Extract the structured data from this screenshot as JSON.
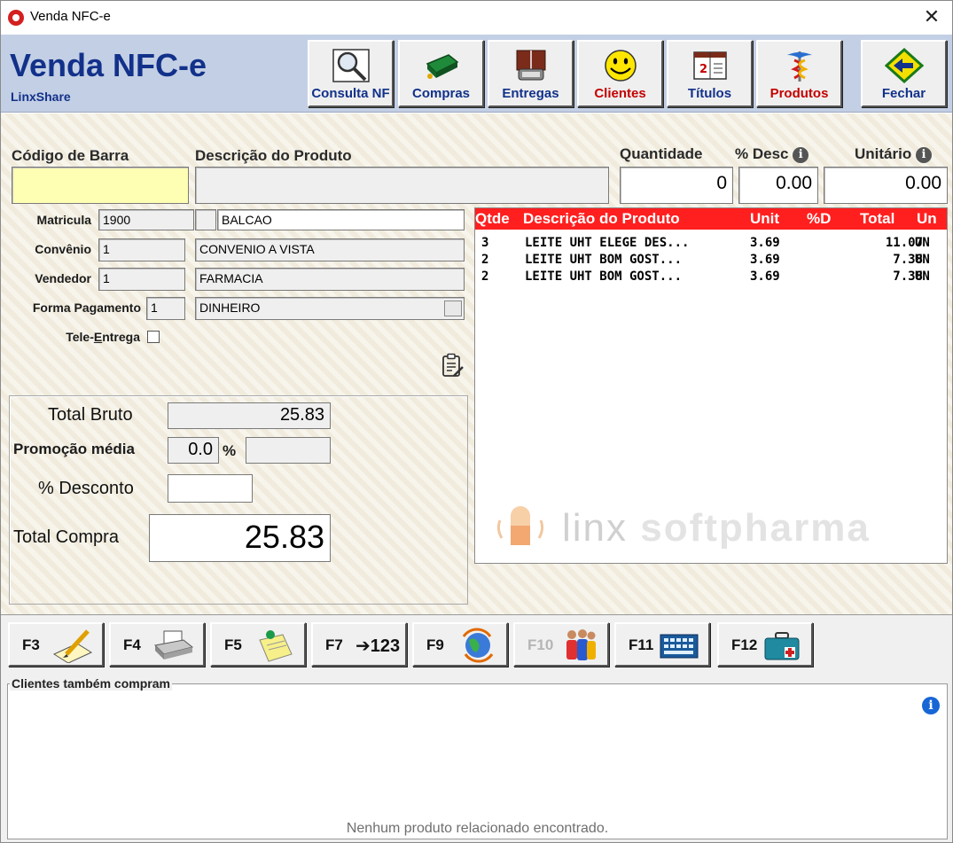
{
  "window": {
    "title": "Venda NFC-e",
    "close_glyph": "✕"
  },
  "header": {
    "title": "Venda NFC-e",
    "subtitle": "LinxShare",
    "buttons": [
      {
        "label": "Consulta NF",
        "icon": "magnifier-icon",
        "color": "#12318a"
      },
      {
        "label": "Compras",
        "icon": "cash-register-icon",
        "color": "#12318a"
      },
      {
        "label": "Entregas",
        "icon": "telephone-book-icon",
        "color": "#12318a"
      },
      {
        "label": "Clientes",
        "icon": "smiley-icon",
        "color": "#c40000"
      },
      {
        "label": "Títulos",
        "icon": "calendar-book-icon",
        "color": "#12318a"
      },
      {
        "label": "Produtos",
        "icon": "caduceus-icon",
        "color": "#c40000"
      },
      {
        "label": "Fechar",
        "icon": "back-arrow-icon",
        "color": "#12318a"
      }
    ]
  },
  "entry": {
    "barcode_label": "Código de Barra",
    "barcode_value": "",
    "description_label": "Descrição do Produto",
    "description_value": "",
    "quantity_label": "Quantidade",
    "quantity_value": "0",
    "discount_label": "% Desc",
    "discount_value": "0.00",
    "unit_label": "Unitário",
    "unit_value": "0.00",
    "info_glyph": "i"
  },
  "form": {
    "matricula_label": "Matricula",
    "matricula_code": "1900",
    "matricula_name": "BALCAO",
    "convenio_label": "Convênio",
    "convenio_code": "1",
    "convenio_name": "CONVENIO A VISTA",
    "vendedor_label": "Vendedor",
    "vendedor_code": "1",
    "vendedor_name": "FARMACIA",
    "pagamento_label": "Forma Pagamento",
    "pagamento_code": "1",
    "pagamento_name": "DINHEIRO",
    "tele_label_pre": "Tele-",
    "tele_label_underlined": "E",
    "tele_label_post": "ntrega",
    "tele_checked": false
  },
  "totals": {
    "bruto_label": "Total Bruto",
    "bruto_value": "25.83",
    "promo_label": "Promoção média",
    "promo_value": "0.0",
    "promo_unit": "%",
    "promo_extra": "",
    "desconto_label": "% Desconto",
    "desconto_value": "",
    "compra_label": "Total Compra",
    "compra_value": "25.83"
  },
  "items": {
    "header": {
      "qtde": "Qtde",
      "desc": "Descrição do Produto",
      "unit": "Unit",
      "pd": "%D",
      "total": "Total",
      "un": "Un"
    },
    "rows": [
      {
        "qtde": "3",
        "desc": "LEITE UHT ELEGE DES...",
        "unit": "3.69",
        "pd": "",
        "total": "11.07",
        "un": "UN"
      },
      {
        "qtde": "2",
        "desc": "LEITE UHT BOM GOST...",
        "unit": "3.69",
        "pd": "",
        "total": "7.38",
        "un": "UN"
      },
      {
        "qtde": "2",
        "desc": "LEITE UHT BOM GOST...",
        "unit": "3.69",
        "pd": "",
        "total": "7.38",
        "un": "UN"
      }
    ],
    "watermark_a": "linx",
    "watermark_b": "softpharma"
  },
  "fkeys": [
    {
      "key": "F3",
      "icon": "pencil-paper-icon",
      "enabled": true
    },
    {
      "key": "F4",
      "icon": "printer-icon",
      "enabled": true
    },
    {
      "key": "F5",
      "icon": "sticky-note-icon",
      "enabled": true
    },
    {
      "key": "F7",
      "icon": "arrow-123-icon",
      "enabled": true,
      "text": "➔123"
    },
    {
      "key": "F9",
      "icon": "globe-refresh-icon",
      "enabled": true
    },
    {
      "key": "F10",
      "icon": "people-icon",
      "enabled": false
    },
    {
      "key": "F11",
      "icon": "keyboard-icon",
      "enabled": true
    },
    {
      "key": "F12",
      "icon": "medical-kit-icon",
      "enabled": true
    }
  ],
  "related": {
    "title": "Clientes também compram",
    "empty_message": "Nenhum produto relacionado encontrado.",
    "info_glyph": "i"
  }
}
